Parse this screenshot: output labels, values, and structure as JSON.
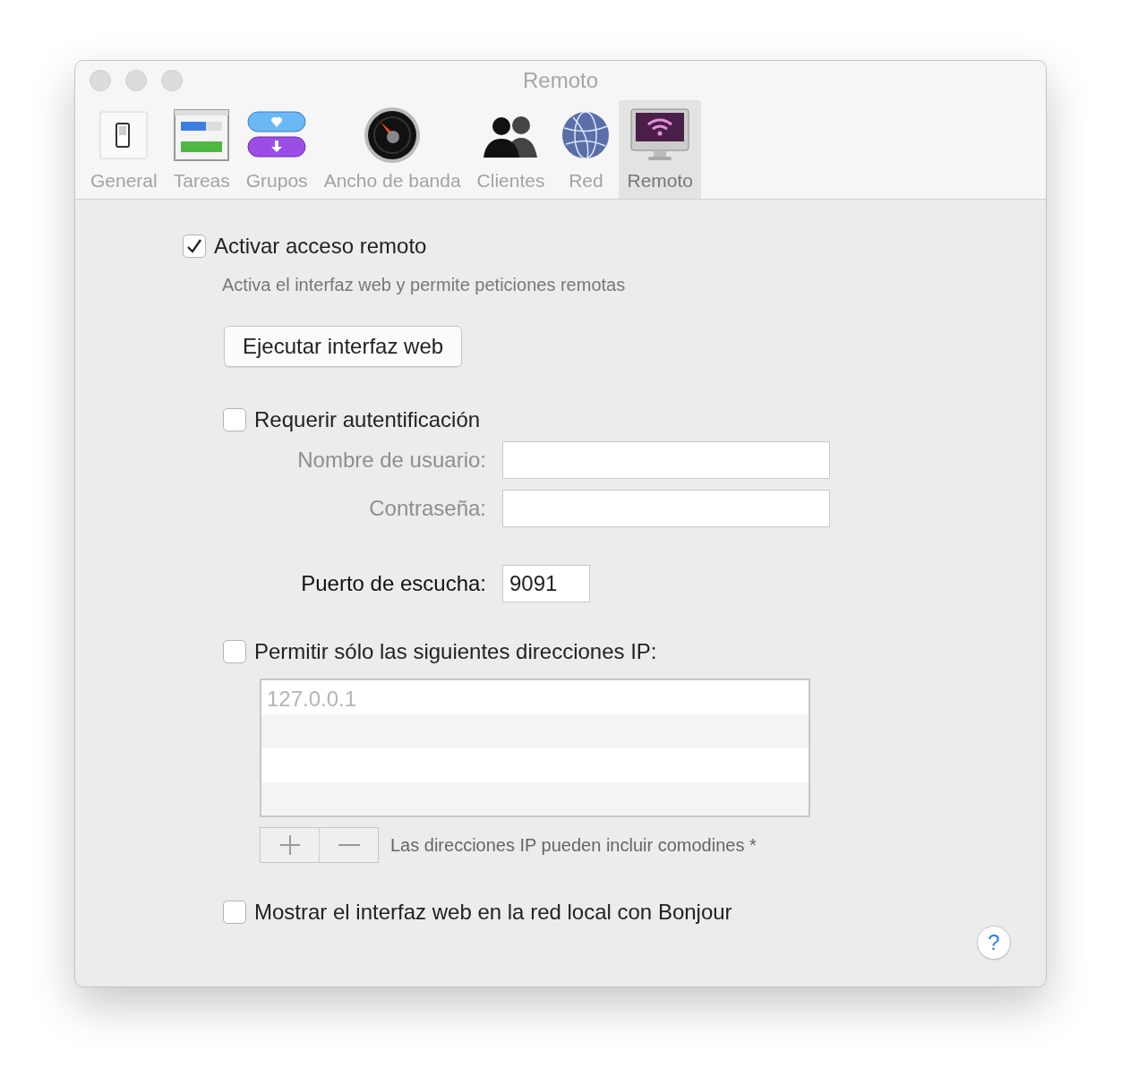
{
  "window": {
    "title": "Remoto"
  },
  "toolbar": [
    {
      "label": "General",
      "selected": false
    },
    {
      "label": "Tareas",
      "selected": false
    },
    {
      "label": "Grupos",
      "selected": false
    },
    {
      "label": "Ancho de banda",
      "selected": false
    },
    {
      "label": "Clientes",
      "selected": false
    },
    {
      "label": "Red",
      "selected": false
    },
    {
      "label": "Remoto",
      "selected": true
    }
  ],
  "remote_access": {
    "label": "Activar acceso remoto",
    "checked": true,
    "description": "Activa el interfaz web y permite peticiones remotas"
  },
  "launch_button": "Ejecutar interfaz web",
  "authentication": {
    "label": "Requerir autentificación",
    "checked": false,
    "fields": [
      {
        "label": "Nombre de usuario:"
      },
      {
        "label": "Contraseña:"
      }
    ]
  },
  "port": {
    "label": "Puerto de escucha:",
    "value": "9091"
  },
  "ip_filter": {
    "label": "Permitir sólo las siguientes direcciones IP:",
    "checked": false,
    "addresses": [
      "127.0.0.1"
    ],
    "hint": "Las direcciones IP pueden incluir comodines *"
  },
  "bonjour": {
    "label": "Mostrar el interfaz web en la red local con Bonjour",
    "checked": false
  },
  "help_button": "?"
}
